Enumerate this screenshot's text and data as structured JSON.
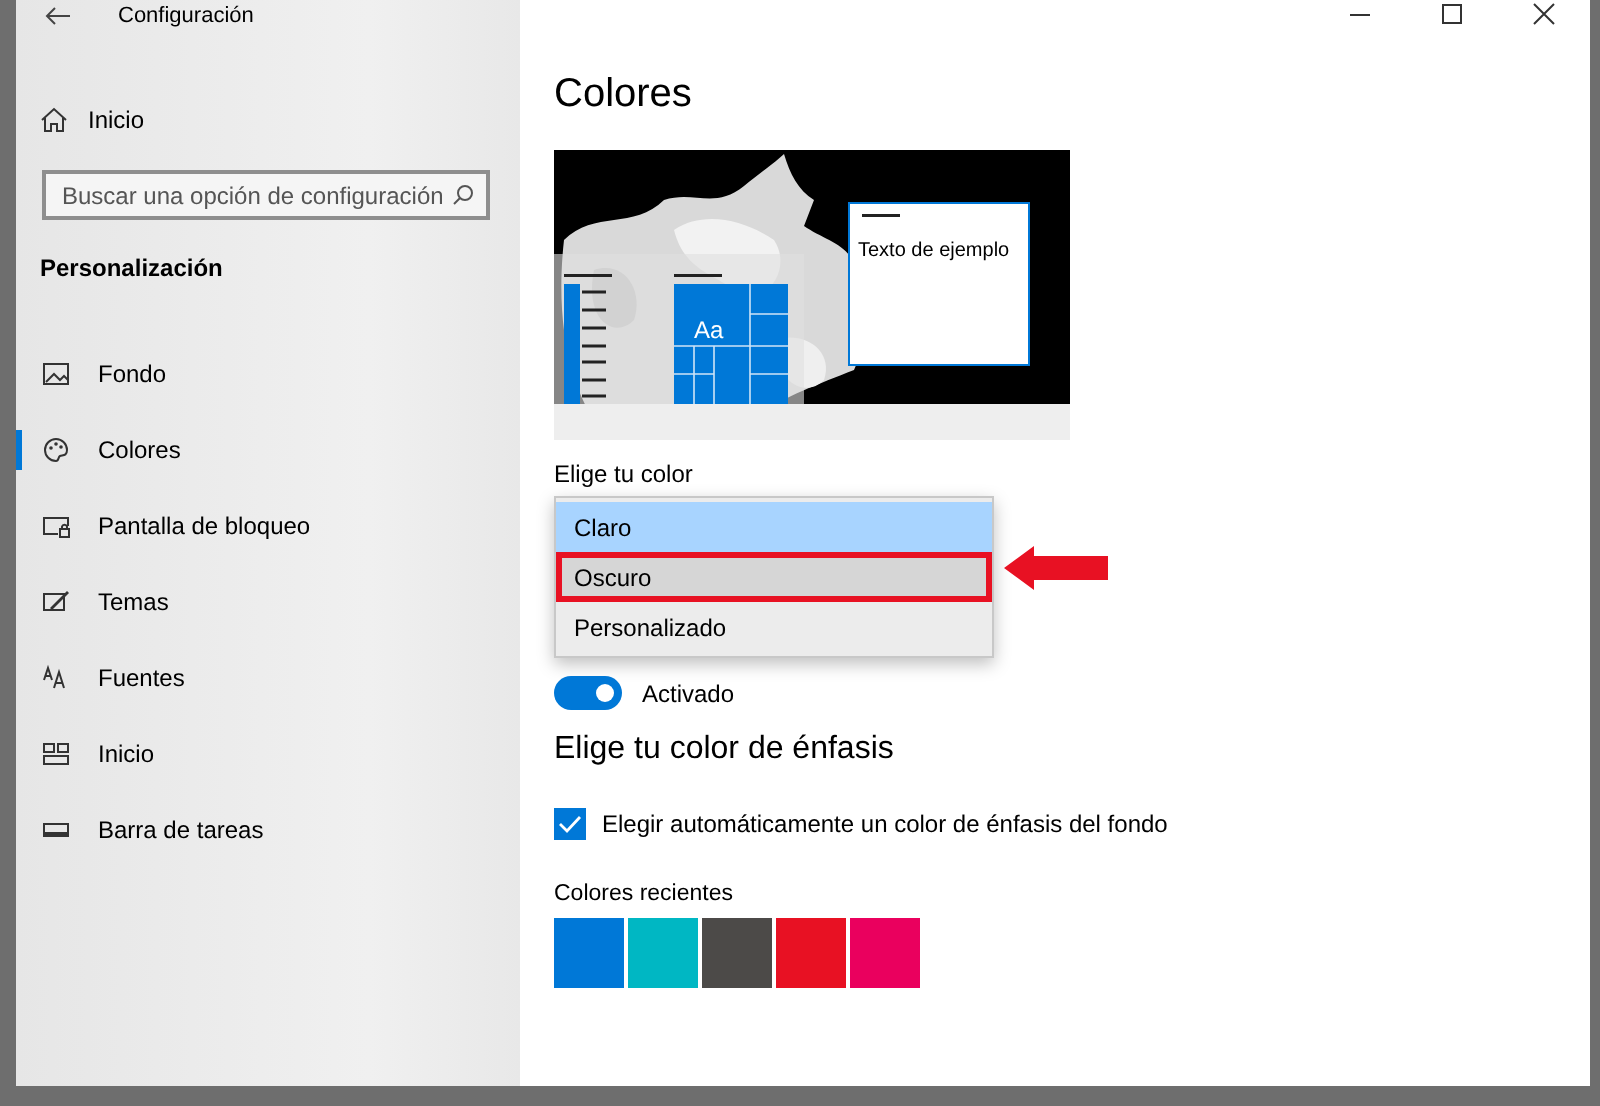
{
  "window": {
    "title": "Configuración"
  },
  "sidebar": {
    "home": {
      "label": "Inicio"
    },
    "search": {
      "placeholder": "Buscar una opción de configuración"
    },
    "section": "Personalización",
    "items": [
      {
        "label": "Fondo",
        "selected": false
      },
      {
        "label": "Colores",
        "selected": true
      },
      {
        "label": "Pantalla de bloqueo",
        "selected": false
      },
      {
        "label": "Temas",
        "selected": false
      },
      {
        "label": "Fuentes",
        "selected": false
      },
      {
        "label": "Inicio",
        "selected": false
      },
      {
        "label": "Barra de tareas",
        "selected": false
      }
    ]
  },
  "content": {
    "heading": "Colores",
    "preview": {
      "tile_label": "Aa",
      "sample_text": "Texto de ejemplo"
    },
    "color_mode": {
      "label": "Elige tu color",
      "options": [
        {
          "label": "Claro",
          "selected": true,
          "hovered": false,
          "annotated": false
        },
        {
          "label": "Oscuro",
          "selected": false,
          "hovered": true,
          "annotated": true
        },
        {
          "label": "Personalizado",
          "selected": false,
          "hovered": false,
          "annotated": false
        }
      ]
    },
    "transparency": {
      "label": "Activado",
      "on": true
    },
    "accent": {
      "heading": "Elige tu color de énfasis",
      "auto": {
        "label": "Elegir automáticamente un color de énfasis del fondo",
        "checked": true
      },
      "recent_label": "Colores recientes",
      "swatches": [
        {
          "color": "#0078d7"
        },
        {
          "color": "#00b7c3"
        },
        {
          "color": "#4c4a48"
        },
        {
          "color": "#e81123"
        },
        {
          "color": "#ea005e"
        }
      ]
    }
  }
}
